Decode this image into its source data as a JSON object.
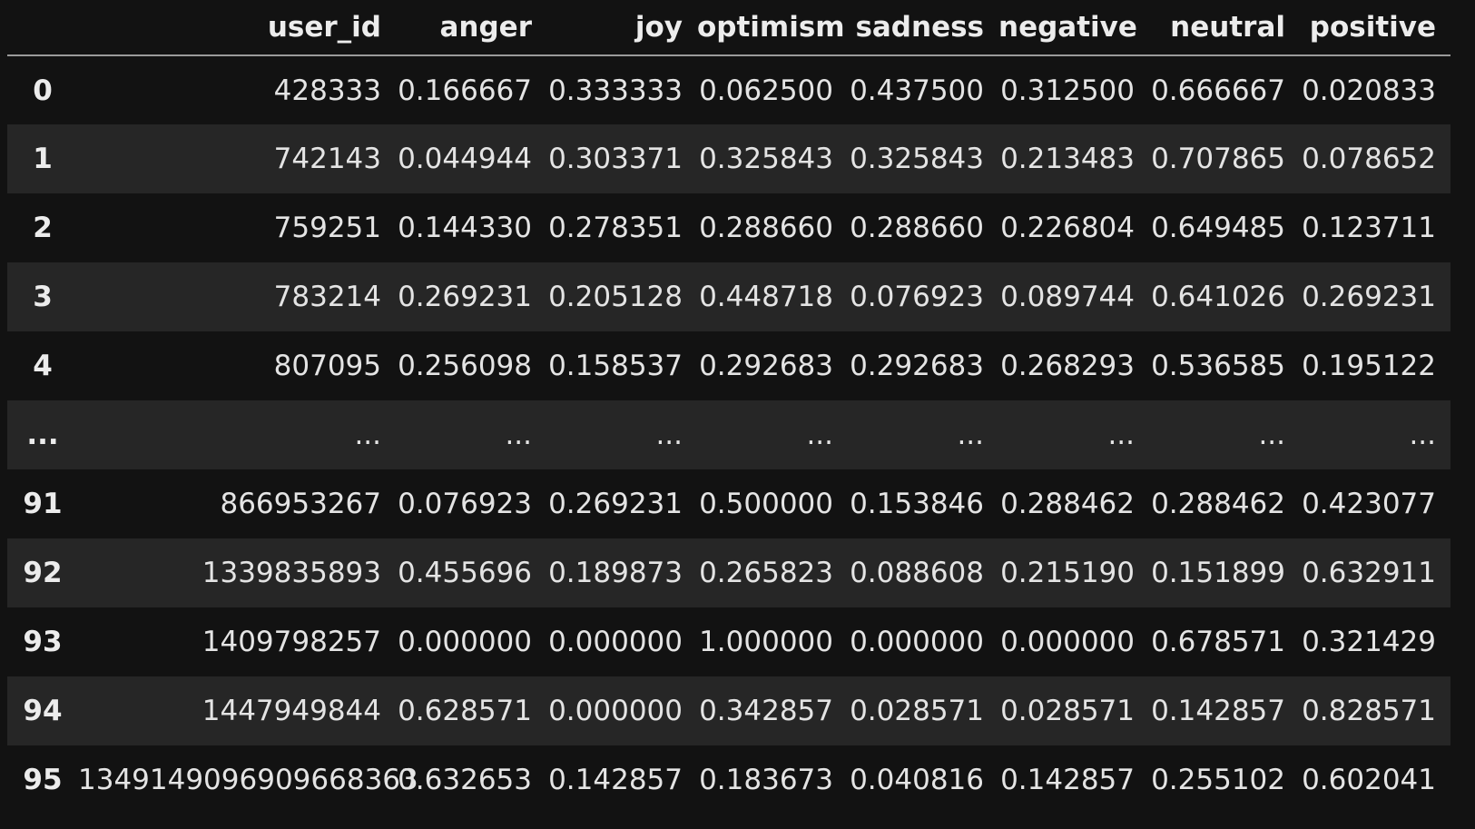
{
  "table": {
    "columns": [
      "",
      "user_id",
      "anger",
      "joy",
      "optimism",
      "sadness",
      "negative",
      "neutral",
      "positive"
    ],
    "rows": [
      [
        "0",
        "428333",
        "0.166667",
        "0.333333",
        "0.062500",
        "0.437500",
        "0.312500",
        "0.666667",
        "0.020833"
      ],
      [
        "1",
        "742143",
        "0.044944",
        "0.303371",
        "0.325843",
        "0.325843",
        "0.213483",
        "0.707865",
        "0.078652"
      ],
      [
        "2",
        "759251",
        "0.144330",
        "0.278351",
        "0.288660",
        "0.288660",
        "0.226804",
        "0.649485",
        "0.123711"
      ],
      [
        "3",
        "783214",
        "0.269231",
        "0.205128",
        "0.448718",
        "0.076923",
        "0.089744",
        "0.641026",
        "0.269231"
      ],
      [
        "4",
        "807095",
        "0.256098",
        "0.158537",
        "0.292683",
        "0.292683",
        "0.268293",
        "0.536585",
        "0.195122"
      ],
      [
        "...",
        "...",
        "...",
        "...",
        "...",
        "...",
        "...",
        "...",
        "..."
      ],
      [
        "91",
        "866953267",
        "0.076923",
        "0.269231",
        "0.500000",
        "0.153846",
        "0.288462",
        "0.288462",
        "0.423077"
      ],
      [
        "92",
        "1339835893",
        "0.455696",
        "0.189873",
        "0.265823",
        "0.088608",
        "0.215190",
        "0.151899",
        "0.632911"
      ],
      [
        "93",
        "1409798257",
        "0.000000",
        "0.000000",
        "1.000000",
        "0.000000",
        "0.000000",
        "0.678571",
        "0.321429"
      ],
      [
        "94",
        "1447949844",
        "0.628571",
        "0.000000",
        "0.342857",
        "0.028571",
        "0.028571",
        "0.142857",
        "0.828571"
      ],
      [
        "95",
        "1349149096909668363",
        "0.632653",
        "0.142857",
        "0.183673",
        "0.040816",
        "0.142857",
        "0.255102",
        "0.602041"
      ]
    ]
  }
}
